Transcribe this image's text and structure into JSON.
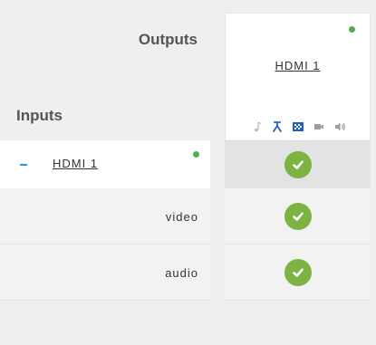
{
  "header": {
    "outputs_label": "Outputs",
    "inputs_label": "Inputs"
  },
  "outputs": [
    {
      "name": "HDMI 1",
      "status": "connected",
      "icons": [
        "music-icon",
        "crossing-icon",
        "test-pattern-icon",
        "video-camera-icon",
        "speaker-icon"
      ]
    }
  ],
  "inputs": [
    {
      "name": "HDMI 1",
      "status": "connected",
      "expanded": true,
      "collapse_symbol": "-",
      "sub_rows": [
        {
          "label": "video",
          "routed": true
        },
        {
          "label": "audio",
          "routed": true
        }
      ],
      "routed": true
    }
  ],
  "colors": {
    "status_green": "#4cb050",
    "check_green": "#7cb342",
    "toggle_blue": "#2196f3",
    "text": "#333333",
    "header_text": "#555555"
  }
}
